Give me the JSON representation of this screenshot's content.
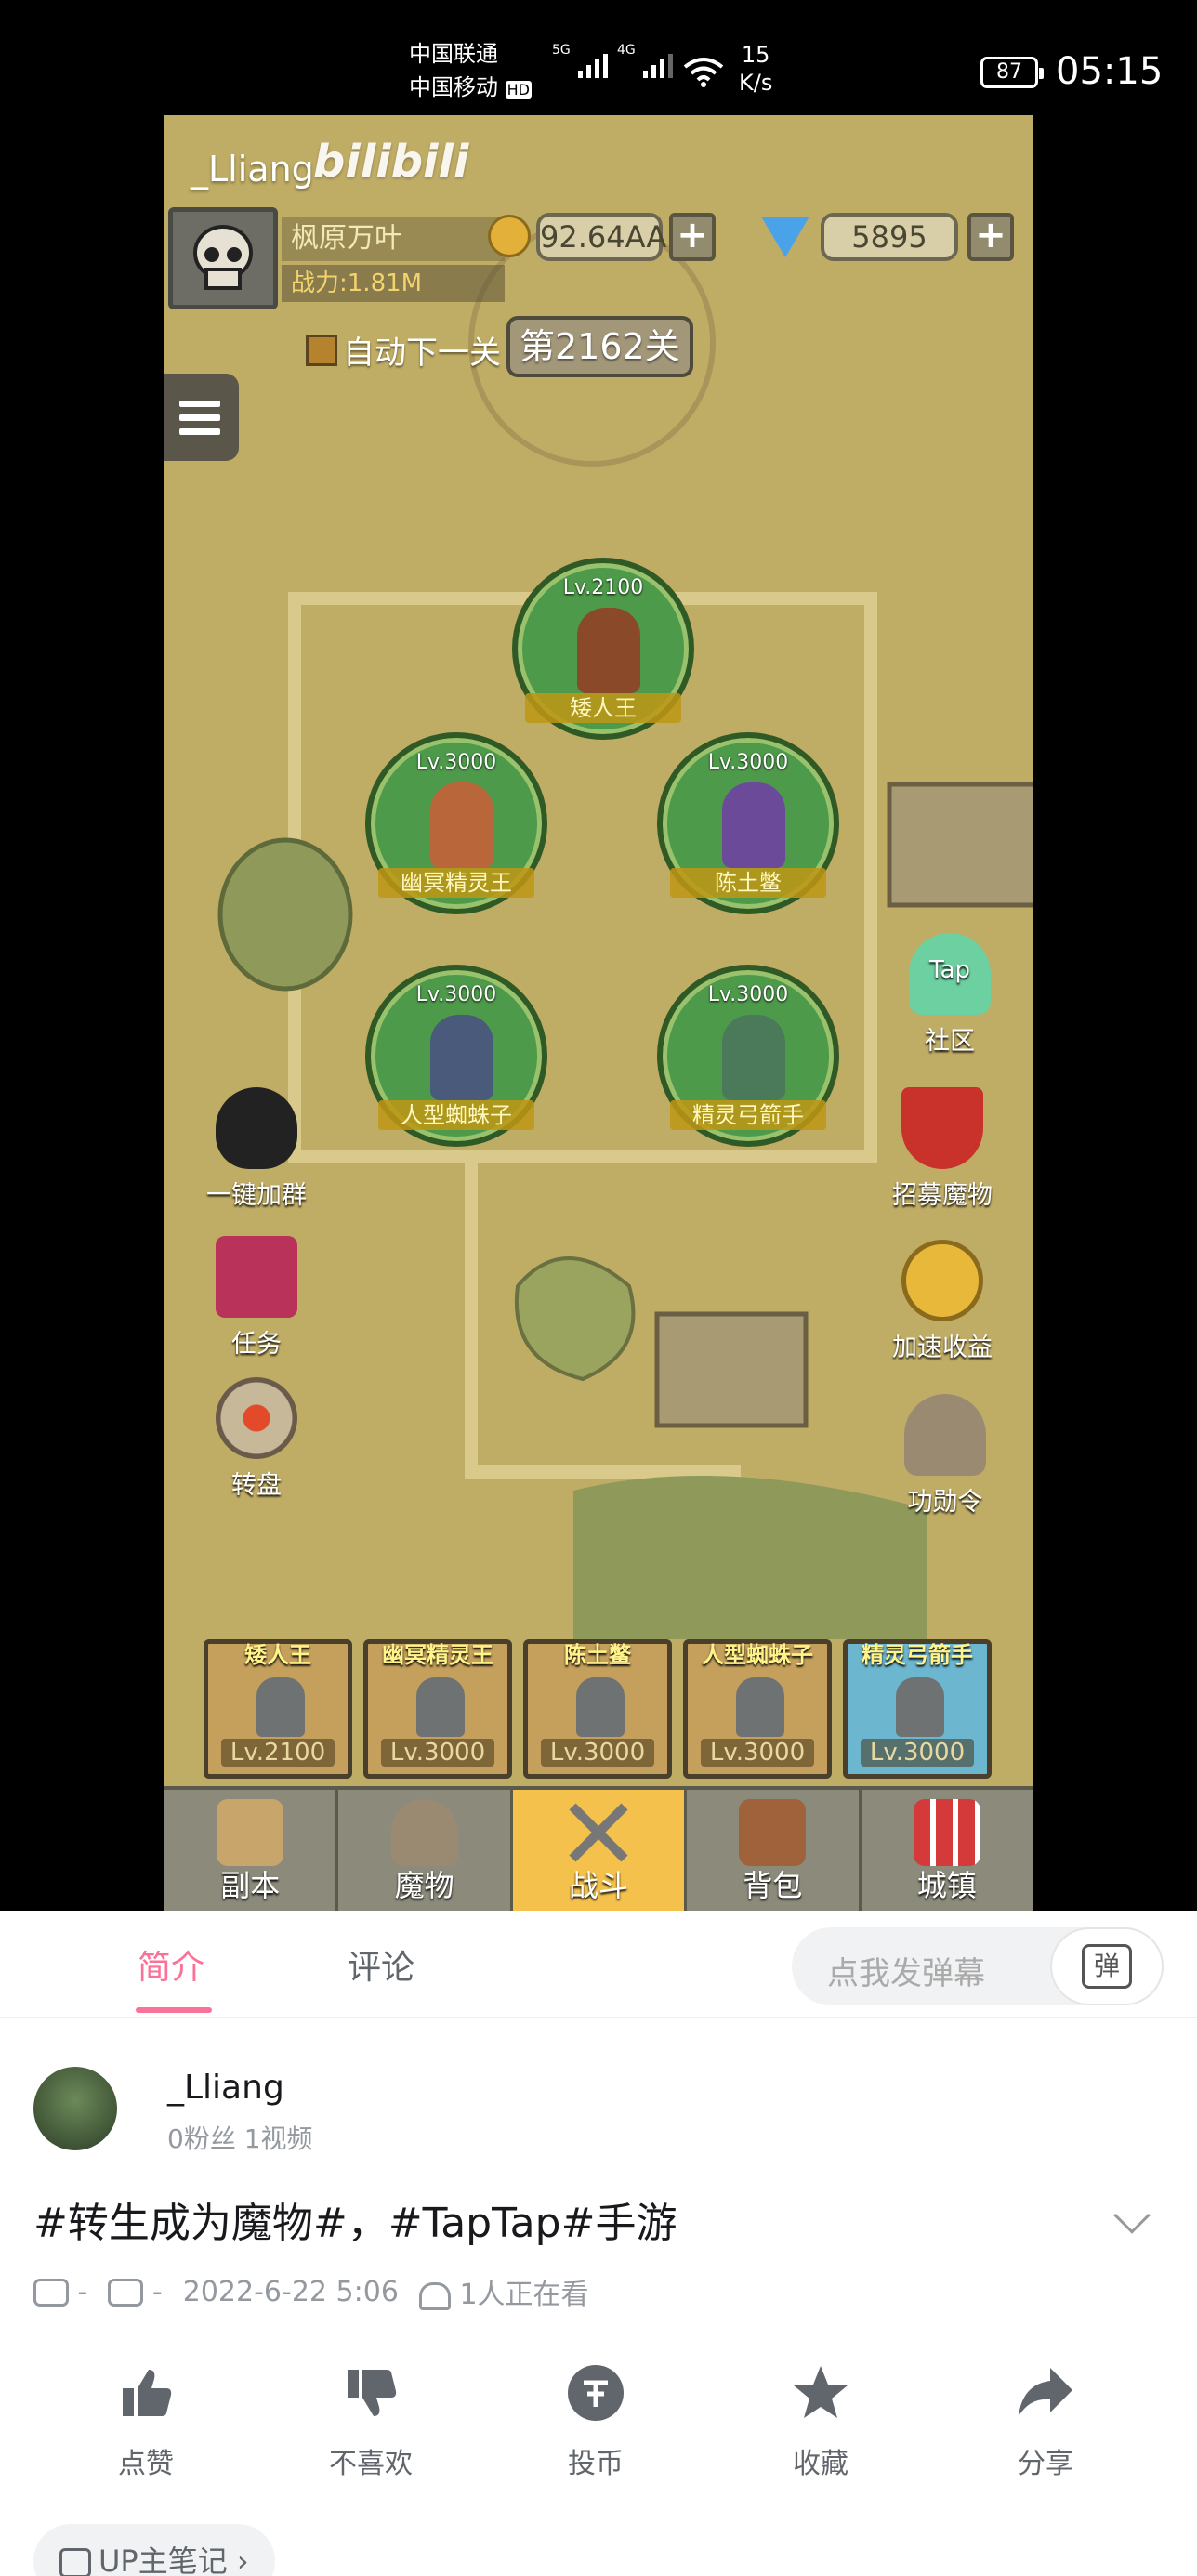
{
  "status": {
    "carrier1": "中国联通",
    "carrier2": "中国移动",
    "hd": "HD",
    "net1": "5G",
    "net2": "4G",
    "speed_value": "15",
    "speed_unit": "K/s",
    "battery": "87",
    "time": "05:15"
  },
  "game": {
    "watermark_user": "_Lliang",
    "watermark_site": "bilibili",
    "player_name": "枫原万叶",
    "power": "战力:1.81M",
    "gold": "92.64AA",
    "gems": "5895",
    "plus": "+",
    "auto_next": "自动下一关",
    "stage": "第2162关",
    "units": [
      {
        "level": "Lv.2100",
        "name": "矮人王"
      },
      {
        "level": "Lv.3000",
        "name": "幽冥精灵王"
      },
      {
        "level": "Lv.3000",
        "name": "陈土鳖"
      },
      {
        "level": "Lv.3000",
        "name": "人型蜘蛛子"
      },
      {
        "level": "Lv.3000",
        "name": "精灵弓箭手"
      }
    ],
    "left_buttons": [
      {
        "label": "一键加群",
        "icon": "qq-penguin-icon"
      },
      {
        "label": "任务",
        "icon": "quest-book-icon"
      },
      {
        "label": "转盘",
        "icon": "wheel-icon"
      }
    ],
    "right_buttons": [
      {
        "label": "社区",
        "icon": "tap-community-icon",
        "badge": "Tap"
      },
      {
        "label": "招募魔物",
        "icon": "recruit-banner-icon"
      },
      {
        "label": "加速收益",
        "icon": "speed-coin-icon"
      },
      {
        "label": "功勋令",
        "icon": "helmet-icon"
      }
    ],
    "hero_slots": [
      {
        "name": "矮人王",
        "level": "Lv.2100"
      },
      {
        "name": "幽冥精灵王",
        "level": "Lv.3000"
      },
      {
        "name": "陈土鳖",
        "level": "Lv.3000"
      },
      {
        "name": "人型蜘蛛子",
        "level": "Lv.3000"
      },
      {
        "name": "精灵弓箭手",
        "level": "Lv.3000"
      }
    ],
    "nav": [
      {
        "label": "副本",
        "active": false
      },
      {
        "label": "魔物",
        "active": false
      },
      {
        "label": "战斗",
        "active": true
      },
      {
        "label": "背包",
        "active": false
      },
      {
        "label": "城镇",
        "active": false
      }
    ]
  },
  "sheet": {
    "tab_intro": "简介",
    "tab_comments": "评论",
    "danmaku_placeholder": "点我发弹幕",
    "danmaku_button": "弹",
    "up_name": "_Lliang",
    "up_stats": "0粉丝    1视频",
    "title": "#转生成为魔物#，#TapTap#手游",
    "plays": "-",
    "danmaku_count": "-",
    "date": "2022-6-22 5:06",
    "watching": "1人正在看",
    "actions": [
      {
        "label": "点赞",
        "icon": "thumbs-up-icon"
      },
      {
        "label": "不喜欢",
        "icon": "thumbs-down-icon"
      },
      {
        "label": "投币",
        "icon": "coin-icon"
      },
      {
        "label": "收藏",
        "icon": "star-icon"
      },
      {
        "label": "分享",
        "icon": "share-icon"
      }
    ],
    "notes": "UP主笔记 ›"
  },
  "colors": {
    "accent": "#fb7299",
    "game_bg": "#c0ad65"
  }
}
